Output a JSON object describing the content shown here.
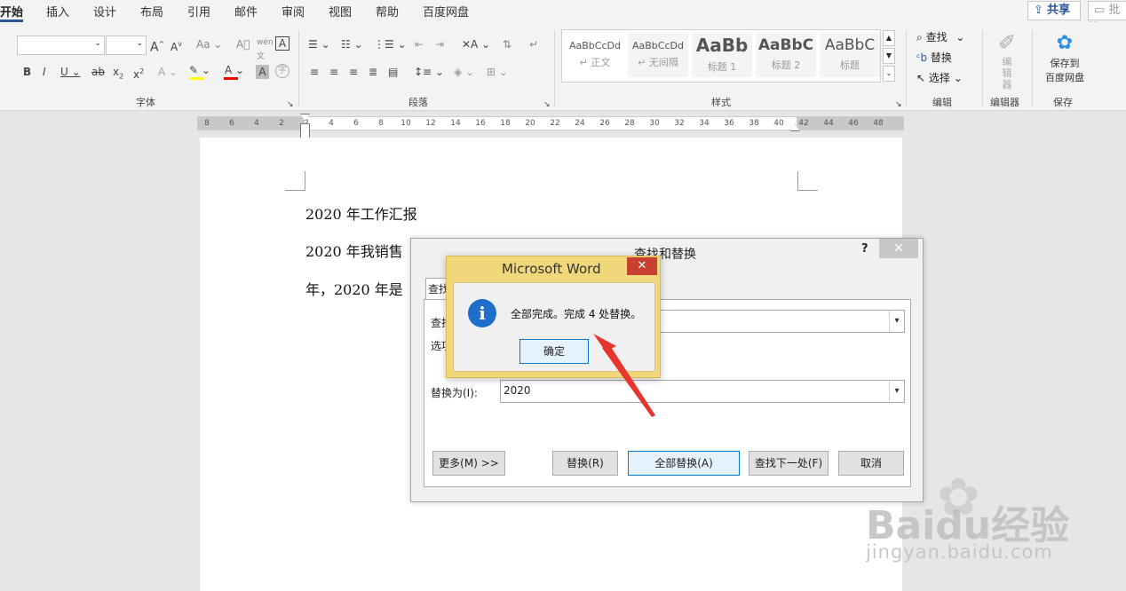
{
  "tabs": [
    "开始",
    "插入",
    "设计",
    "布局",
    "引用",
    "邮件",
    "审阅",
    "视图",
    "帮助",
    "百度网盘"
  ],
  "share_label": "共享",
  "comments_label": "批注",
  "font_group": {
    "label": "字体"
  },
  "paragraph_group": {
    "label": "段落"
  },
  "styles_group": {
    "label": "样式",
    "items": [
      {
        "sample": "AaBbCcDd",
        "name": "↵ 正文"
      },
      {
        "sample": "AaBbCcDd",
        "name": "↵ 无间隔"
      },
      {
        "sample": "AaBb",
        "name": "标题 1"
      },
      {
        "sample": "AaBbC",
        "name": "标题 2"
      },
      {
        "sample": "AaBbC",
        "name": "标题"
      }
    ]
  },
  "editing_group": {
    "label": "编辑",
    "find": "查找",
    "replace": "替换",
    "select": "选择"
  },
  "editor_group": {
    "label": "编辑器",
    "button": "编辑器"
  },
  "save_group": {
    "label": "保存",
    "button_line1": "保存到",
    "button_line2": "百度网盘"
  },
  "ruler_ticks": [
    "8",
    "6",
    "4",
    "2",
    "2",
    "4",
    "6",
    "8",
    "10",
    "12",
    "14",
    "16",
    "18",
    "20",
    "22",
    "24",
    "26",
    "28",
    "30",
    "32",
    "34",
    "36",
    "38",
    "40",
    "42",
    "44",
    "46",
    "48"
  ],
  "document": {
    "lines": [
      "2020 年工作汇报",
      "2020 年我销售",
      "年，2020 年是"
    ]
  },
  "find_dialog": {
    "title": "查找和替换",
    "help": "?",
    "tab_find": "查找",
    "find_label": "查找",
    "options_label": "选项",
    "replace_label": "替换为(I):",
    "replace_value": "2020",
    "more_button": "更多(M) >>",
    "replace_button": "替换(R)",
    "replace_all_button": "全部替换(A)",
    "find_next_button": "查找下一处(F)",
    "cancel_button": "取消"
  },
  "message_box": {
    "title": "Microsoft Word",
    "message": "全部完成。完成 4 处替换。",
    "ok_button": "确定"
  },
  "watermark": {
    "brand": "Baidu经验",
    "url": "jingyan.baidu.com"
  },
  "colors": {
    "highlight": "#ffff00",
    "font_color": "#ff0000",
    "arrow": "#e8342f",
    "msgbox_frame": "#f0d87a",
    "dialog_button_focus": "#0078d7"
  }
}
